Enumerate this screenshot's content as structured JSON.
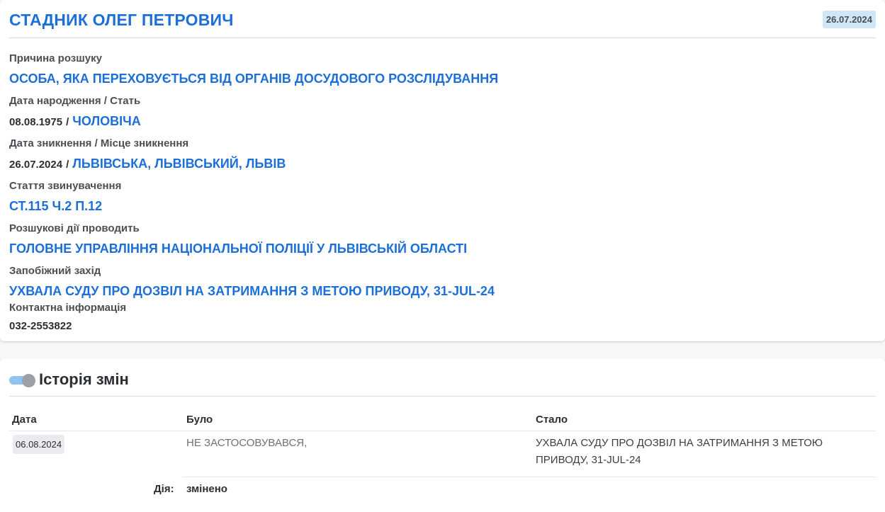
{
  "person": {
    "name": "СТАДНИК ОЛЕГ ПЕТРОВИЧ",
    "date": "26.07.2024"
  },
  "fields": {
    "reason": {
      "label": "Причина розшуку",
      "value": "ОСОБА, ЯКА ПЕРЕХОВУЄТЬСЯ ВІД ОРГАНІВ ДОСУДОВОГО РОЗСЛІДУВАННЯ"
    },
    "birth": {
      "label": "Дата народження / Стать",
      "date": "08.08.1975",
      "separator": "/",
      "sex": "ЧОЛОВІЧА"
    },
    "disappearance": {
      "label": "Дата зникнення / Місце зникнення",
      "date": "26.07.2024",
      "separator": "/",
      "place": "ЛЬВІВСЬКА, ЛЬВІВСЬКИЙ, ЛЬВІВ"
    },
    "article": {
      "label": "Стаття звинувачення",
      "value": "СТ.115 Ч.2 П.12"
    },
    "agency": {
      "label": "Розшукові дії проводить",
      "value": "ГОЛОВНЕ УПРАВЛІННЯ НАЦІОНАЛЬНОЇ ПОЛІЦІЇ У ЛЬВІВСЬКІЙ ОБЛАСТІ"
    },
    "measure": {
      "label": "Запобіжний захід",
      "value": "УХВАЛА СУДУ ПРО ДОЗВІЛ НА ЗАТРИМАННЯ З МЕТОЮ ПРИВОДУ, 31-JUL-24"
    },
    "contact": {
      "label": "Контактна інформація",
      "value": "032-2553822"
    }
  },
  "history": {
    "title": "Історія змін",
    "toggle_on": true,
    "columns": {
      "date": "Дата",
      "was": "Було",
      "now": "Стало"
    },
    "rows": [
      {
        "date": "06.08.2024",
        "was": "НЕ ЗАСТОСОВУВАВСЯ,",
        "now": "УХВАЛА СУДУ ПРО ДОЗВІЛ НА ЗАТРИМАННЯ З МЕТОЮ ПРИВОДУ, 31-JUL-24",
        "action_label": "Дія:",
        "action_value": "змінено"
      }
    ]
  },
  "colors": {
    "accent": "#1d6fd8",
    "badge": "#cfe6f7",
    "toggle_track": "#8fc4f2"
  }
}
